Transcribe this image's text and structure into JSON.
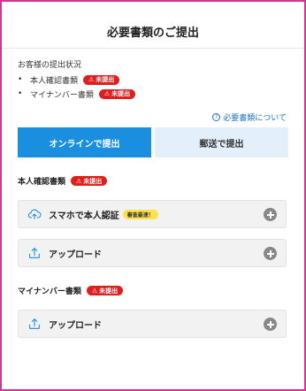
{
  "page": {
    "title": "必要書類のご提出"
  },
  "status": {
    "heading": "お客様の提出状況",
    "items": [
      {
        "label": "本人確認書類",
        "badge": "未提出"
      },
      {
        "label": "マイナンバー書類",
        "badge": "未提出"
      }
    ]
  },
  "help_link": {
    "icon": "question-circle-icon",
    "label": "必要書類について"
  },
  "tabs": [
    {
      "label": "オンラインで提出",
      "active": true
    },
    {
      "label": "郵送で提出",
      "active": false
    }
  ],
  "identity_section": {
    "heading": "本人確認書類",
    "badge": "未提出",
    "options": [
      {
        "icon": "cloud-upload-icon",
        "label": "スマホで本人認証",
        "tag": "審査最速！"
      },
      {
        "icon": "upload-icon",
        "label": "アップロード"
      }
    ]
  },
  "mynumber_section": {
    "heading": "マイナンバー書類",
    "badge": "未提出",
    "options": [
      {
        "icon": "upload-icon",
        "label": "アップロード"
      }
    ]
  },
  "colors": {
    "frame": "#d0358f",
    "accent": "#1a8fe0",
    "badge": "#e01e1e",
    "tag": "#ffe14d"
  }
}
